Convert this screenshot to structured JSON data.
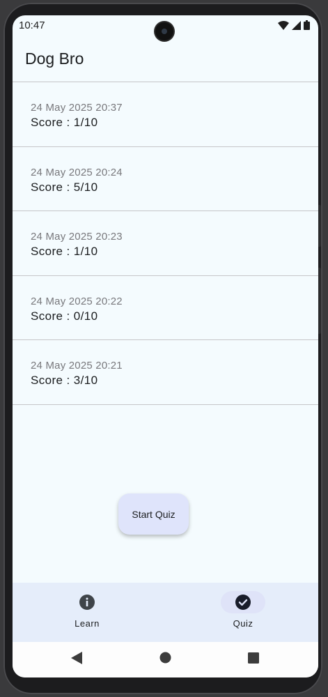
{
  "status_bar": {
    "time": "10:47"
  },
  "app_bar": {
    "title": "Dog Bro"
  },
  "history": [
    {
      "date": "24 May 2025 20:37",
      "score": "Score : 1/10"
    },
    {
      "date": "24 May 2025 20:24",
      "score": "Score : 5/10"
    },
    {
      "date": "24 May 2025 20:23",
      "score": "Score : 1/10"
    },
    {
      "date": "24 May 2025 20:22",
      "score": "Score : 0/10"
    },
    {
      "date": "24 May 2025 20:21",
      "score": "Score : 3/10"
    }
  ],
  "fab": {
    "label": "Start Quiz"
  },
  "bottom_nav": {
    "items": [
      {
        "label": "Learn",
        "icon": "info-icon",
        "selected": false
      },
      {
        "label": "Quiz",
        "icon": "check-circle-icon",
        "selected": true
      }
    ]
  },
  "system_nav": {
    "icons": [
      "back-icon",
      "home-icon",
      "recents-icon"
    ]
  },
  "colors": {
    "background": "#f4fbfe",
    "nav_background": "#e5edfa",
    "fab_background": "#dfe4fb",
    "active_pill": "#dfe3f8"
  }
}
